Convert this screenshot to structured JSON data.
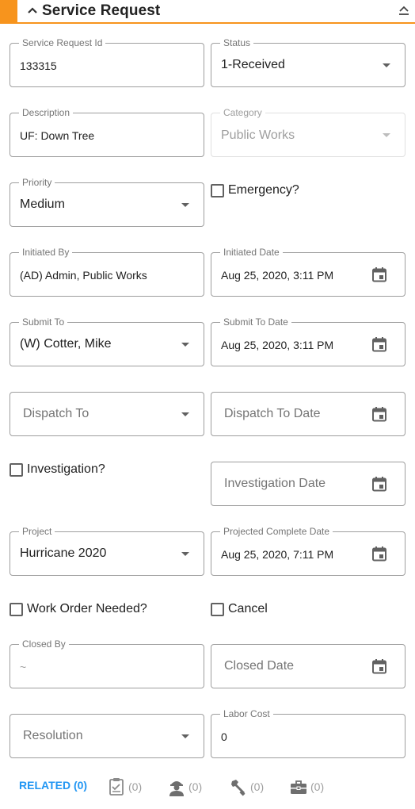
{
  "header": {
    "title": "Service Request"
  },
  "fields": {
    "service_request_id": {
      "label": "Service Request Id",
      "value": "133315"
    },
    "status": {
      "label": "Status",
      "value": "1-Received"
    },
    "description": {
      "label": "Description",
      "value": "UF: Down Tree"
    },
    "category": {
      "label": "Category",
      "value": "Public Works"
    },
    "priority": {
      "label": "Priority",
      "value": "Medium"
    },
    "initiated_by": {
      "label": "Initiated By",
      "value": "(AD) Admin, Public Works"
    },
    "initiated_date": {
      "label": "Initiated Date",
      "value": "Aug 25, 2020, 3:11 PM"
    },
    "submit_to": {
      "label": "Submit To",
      "value": "(W) Cotter, Mike"
    },
    "submit_to_date": {
      "label": "Submit To Date",
      "value": "Aug 25, 2020, 3:11 PM"
    },
    "dispatch_to": {
      "placeholder": "Dispatch To"
    },
    "dispatch_to_date": {
      "placeholder": "Dispatch To Date"
    },
    "investigation_date": {
      "placeholder": "Investigation Date"
    },
    "project": {
      "label": "Project",
      "value": "Hurricane 2020"
    },
    "projected_complete_date": {
      "label": "Projected Complete Date",
      "value": "Aug 25, 2020, 7:11 PM"
    },
    "closed_by": {
      "label": "Closed By",
      "value": "~"
    },
    "closed_date": {
      "placeholder": "Closed Date"
    },
    "resolution": {
      "placeholder": "Resolution"
    },
    "labor_cost": {
      "label": "Labor Cost",
      "value": "0"
    }
  },
  "checkboxes": {
    "emergency": {
      "label": "Emergency?",
      "checked": false
    },
    "investigation": {
      "label": "Investigation?",
      "checked": false
    },
    "work_order_needed": {
      "label": "Work Order Needed?",
      "checked": false
    },
    "cancel": {
      "label": "Cancel",
      "checked": false
    }
  },
  "footer": {
    "related_label": "RELATED (0)",
    "items": [
      {
        "icon": "clipboard-check-icon",
        "count": "(0)"
      },
      {
        "icon": "worker-icon",
        "count": "(0)"
      },
      {
        "icon": "wrench-icon",
        "count": "(0)"
      },
      {
        "icon": "toolbox-icon",
        "count": "(0)"
      }
    ]
  },
  "colors": {
    "accent": "#f7941d",
    "link": "#2196f3",
    "border": "#9e9e9e"
  }
}
